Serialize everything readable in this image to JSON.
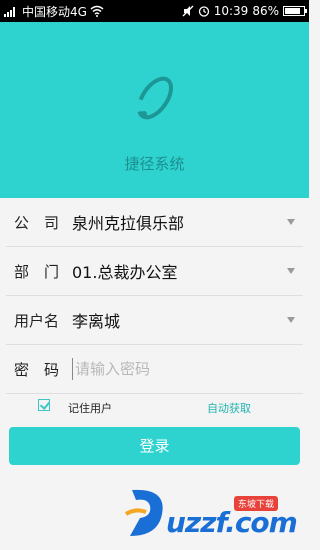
{
  "status_bar": {
    "carrier": "中国移动4G",
    "time": "10:39",
    "battery_percent": "86%",
    "battery_level": 0.86
  },
  "app": {
    "name": "捷径系统",
    "logo_icon": "orbit-logo-icon"
  },
  "form": {
    "company": {
      "label": "公　司",
      "value": "泉州克拉俱乐部"
    },
    "department": {
      "label": "部　门",
      "value": "01.总裁办公室"
    },
    "username": {
      "label": "用户名",
      "value": "李离城"
    },
    "password": {
      "label": "密　码",
      "placeholder": "请输入密码",
      "value": ""
    }
  },
  "options": {
    "remember_label": "记住用户",
    "remember_checked": true,
    "auto_get_label": "自动获取"
  },
  "login_button": "登录",
  "watermark": {
    "text": "uzzf.com",
    "tag": "东坡下载"
  },
  "colors": {
    "accent": "#2ed3d0",
    "accent_dark": "#22b3b0"
  }
}
